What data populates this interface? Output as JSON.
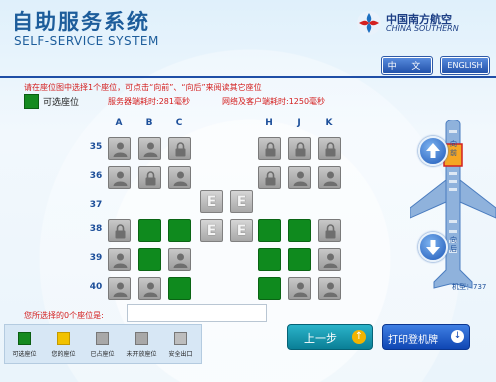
{
  "header": {
    "title_cn": "自助服务系统",
    "title_en": "SELF-SERVICE SYSTEM",
    "logo_cn": "中国南方航空",
    "logo_en": "CHINA SOUTHERN",
    "brand_color": "#1d5d9b"
  },
  "language": {
    "chinese_label": "中 文",
    "english_label": "ENGLISH"
  },
  "info": {
    "instruction": "请在座位图中选择1个座位，可点击“向前”、“向后”来阅读其它座位",
    "legend_available": "可选座位",
    "server_time": "服务器端耗时:281毫秒",
    "network_time": "网络及客户端耗时:1250毫秒"
  },
  "seatmap": {
    "columns": [
      "A",
      "B",
      "C",
      "H",
      "J",
      "K"
    ],
    "rows": [
      {
        "number": "35",
        "seats": [
          "occupied",
          "occupied",
          "locked",
          "locked",
          "locked",
          "locked"
        ]
      },
      {
        "number": "36",
        "seats": [
          "occupied",
          "locked",
          "occupied",
          "locked",
          "occupied",
          "occupied"
        ]
      },
      {
        "number": "37",
        "seats": [
          "",
          "",
          "",
          "",
          "",
          ""
        ]
      },
      {
        "number": "38",
        "seats": [
          "locked",
          "available",
          "available",
          "available",
          "available",
          "locked"
        ]
      },
      {
        "number": "39",
        "seats": [
          "occupied",
          "available",
          "occupied",
          "available",
          "available",
          "occupied"
        ]
      },
      {
        "number": "40",
        "seats": [
          "occupied",
          "occupied",
          "available",
          "available",
          "occupied",
          "occupied"
        ]
      }
    ],
    "exit_label": "E"
  },
  "navigation": {
    "forward_label": "向前",
    "backward_label": "向后",
    "model": "机型：737"
  },
  "selection": {
    "label": "您所选择的0个座位是:",
    "value": ""
  },
  "legend": [
    {
      "label": "可选座位",
      "color": "#158a20"
    },
    {
      "label": "您的座位",
      "color": "#f2c200"
    },
    {
      "label": "已占座位",
      "color": "#a8a8a8"
    },
    {
      "label": "未开放座位",
      "color": "#a8a8a8"
    },
    {
      "label": "安全出口",
      "color": "#a8a8a8"
    }
  ],
  "buttons": {
    "prev_label": "上一步",
    "print_label": "打印登机牌"
  }
}
